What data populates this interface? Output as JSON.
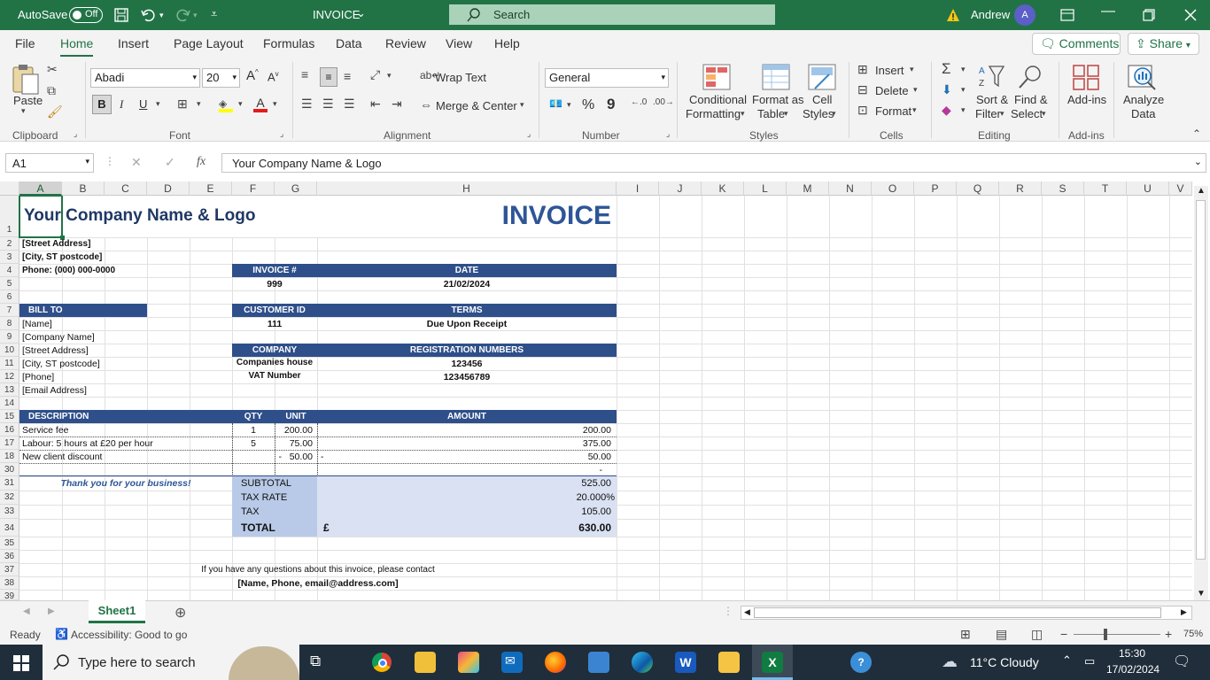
{
  "titlebar": {
    "autosave_label": "AutoSave",
    "autosave_state": "Off",
    "doc_title": "INVOICE",
    "search_placeholder": "Search",
    "user_name": "Andrew",
    "user_initial": "A"
  },
  "menu": {
    "items": [
      "File",
      "Home",
      "Insert",
      "Page Layout",
      "Formulas",
      "Data",
      "Review",
      "View",
      "Help"
    ],
    "active": "Home",
    "comments_label": "Comments",
    "share_label": "Share"
  },
  "ribbon": {
    "clipboard": {
      "paste": "Paste",
      "group": "Clipboard"
    },
    "font": {
      "name": "Abadi",
      "size": "20",
      "group": "Font",
      "bold": "B",
      "italic": "I",
      "underline": "U"
    },
    "alignment": {
      "wrap": "Wrap Text",
      "merge": "Merge & Center",
      "group": "Alignment"
    },
    "number": {
      "format": "General",
      "group": "Number",
      "percent": "%",
      "comma": "9"
    },
    "styles": {
      "conditional_1": "Conditional",
      "conditional_2": "Formatting",
      "table_1": "Format as",
      "table_2": "Table",
      "cell_1": "Cell",
      "cell_2": "Styles",
      "group": "Styles"
    },
    "cells": {
      "insert": "Insert",
      "delete": "Delete",
      "format": "Format",
      "group": "Cells"
    },
    "editing": {
      "sort_1": "Sort &",
      "sort_2": "Filter",
      "find_1": "Find &",
      "find_2": "Select",
      "group": "Editing"
    },
    "addins": {
      "label": "Add-ins",
      "group": "Add-ins"
    },
    "analyze": {
      "label_1": "Analyze",
      "label_2": "Data"
    }
  },
  "formula_bar": {
    "name_box": "A1",
    "fx": "fx",
    "value": "Your Company Name & Logo"
  },
  "columns": [
    "A",
    "B",
    "C",
    "D",
    "E",
    "F",
    "G",
    "H",
    "I",
    "J",
    "K",
    "L",
    "M",
    "N",
    "O",
    "P",
    "Q",
    "R",
    "S",
    "T",
    "U",
    "V"
  ],
  "row_numbers": [
    "1",
    "2",
    "3",
    "4",
    "5",
    "6",
    "7",
    "8",
    "9",
    "10",
    "11",
    "12",
    "13",
    "14",
    "15",
    "16",
    "17",
    "18",
    "30",
    "31",
    "32",
    "33",
    "34",
    "35",
    "36",
    "37",
    "38",
    "39"
  ],
  "invoice": {
    "company_name": "Your Company Name & Logo",
    "title": "INVOICE",
    "street": "[Street Address]",
    "city": "[City, ST  postcode]",
    "phone": "Phone: (000) 000-0000",
    "invoice_no_label": "INVOICE #",
    "invoice_no": "999",
    "date_label": "DATE",
    "date": "21/02/2024",
    "bill_to_label": "BILL TO",
    "bill_to": [
      "[Name]",
      "[Company Name]",
      "[Street Address]",
      "[City, ST  postcode]",
      "[Phone]",
      "[Email Address]"
    ],
    "customer_id_label": "CUSTOMER ID",
    "customer_id": "111",
    "terms_label": "TERMS",
    "terms": "Due Upon Receipt",
    "company_label": "COMPANY",
    "registration_label": "REGISTRATION NUMBERS",
    "companies_house_label": "Companies house",
    "companies_house": "123456",
    "vat_label": "VAT Number",
    "vat": "123456789",
    "desc_label": "DESCRIPTION",
    "qty_label": "QTY",
    "unit_label": "UNIT PRICE",
    "amount_label": "AMOUNT",
    "items": [
      {
        "desc": "Service fee",
        "qty": "1",
        "unit": "200.00",
        "amount": "200.00"
      },
      {
        "desc": "Labour: 5 hours at £20 per hour",
        "qty": "5",
        "unit": "75.00",
        "amount": "375.00"
      },
      {
        "desc": "New client discount",
        "qty": "",
        "unit": "-   50.00",
        "amount": "50.00"
      }
    ],
    "dash": "-",
    "thanks": "Thank you for your business!",
    "subtotal_label": "SUBTOTAL",
    "subtotal": "525.00",
    "tax_rate_label": "TAX RATE",
    "tax_rate": "20.000%",
    "tax_label": "TAX",
    "tax": "105.00",
    "total_label": "TOTAL",
    "currency": "£",
    "total": "630.00",
    "questions": "If you have any questions about this invoice, please contact",
    "contact": "[Name, Phone, email@address.com]"
  },
  "sheet": {
    "tab": "Sheet1"
  },
  "status": {
    "ready": "Ready",
    "accessibility": "Accessibility: Good to go",
    "zoom": "75%"
  },
  "taskbar": {
    "search": "Type here to search",
    "weather": "11°C  Cloudy",
    "time": "15:30",
    "date": "17/02/2024"
  }
}
